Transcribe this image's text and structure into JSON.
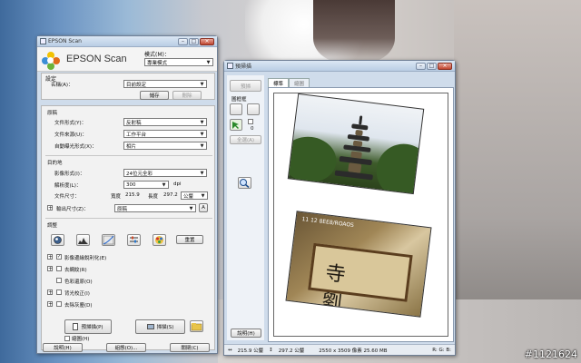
{
  "watermark": "#1121624",
  "epson_window": {
    "title": "EPSON Scan",
    "app_title": "EPSON Scan",
    "mode_label": "模式(M)：",
    "mode_value": "專業模式",
    "settings": {
      "section_label": "設定",
      "name_label": "名稱(A)：",
      "name_value": "目前設定",
      "save_button": "儲存",
      "delete_button": "刪除"
    },
    "original": {
      "section_label": "原稿",
      "doc_type_label": "文件形式(Y)：",
      "doc_type_value": "反射稿",
      "doc_source_label": "文件來源(U)：",
      "doc_source_value": "工作平台",
      "auto_exposure_label": "自動曝光形式(X)：",
      "auto_exposure_value": "相片"
    },
    "destination": {
      "section_label": "目的地",
      "image_type_label": "影像形式(I)：",
      "image_type_value": "24位元全彩",
      "resolution_label": "解析度(L)：",
      "resolution_value": "300",
      "resolution_unit": "dpi",
      "doc_size_label": "文件尺寸：",
      "width_label": "寬度",
      "width_value": "215.9",
      "height_label": "長度",
      "height_value": "297.2",
      "unit_value": "公釐",
      "output_size_label": "輸出尺寸(Z)：",
      "output_size_value": "原稿",
      "output_size_btn": "A"
    },
    "adjustments": {
      "section_label": "調整",
      "reset_button": "重置",
      "options": [
        {
          "label": "影像邊緣銳利化(E)",
          "checked": true
        },
        {
          "label": "去網紋(R)",
          "checked": false
        },
        {
          "label": "色彩還原(O)",
          "checked": false
        },
        {
          "label": "背光校正(I)",
          "checked": false
        },
        {
          "label": "去除灰塵(D)",
          "checked": false
        }
      ]
    },
    "preview_button": "預掃描(P)",
    "thumbnail_label": "縮圖(H)",
    "scan_button": "掃描(S)",
    "help_button": "說明(H)",
    "config_button": "組態(O)...",
    "close_button": "關閉(C)"
  },
  "preview_window": {
    "title": "預掃描",
    "side_buttons": {
      "all_button": "全選(A)",
      "marquee_label": "圖框框",
      "marquee_count": "0",
      "help_button": "說明(H)",
      "top_button": "預掃"
    },
    "tabs": [
      {
        "label": "標準",
        "active": true
      },
      {
        "label": "縮圖",
        "active": false
      }
    ],
    "status": {
      "width": "215.9 公釐",
      "height": "297.2 公釐",
      "size_info": "2550 x 3509 像素 25.60 MB",
      "rgb": "R: G: B:"
    },
    "photo2_stamp": "11 12  8EE8/ROAOS",
    "sign_text": "寺 劉"
  },
  "colors": {
    "window_frame": "#cfdceb",
    "panel_bg": "#f2f2f2"
  }
}
